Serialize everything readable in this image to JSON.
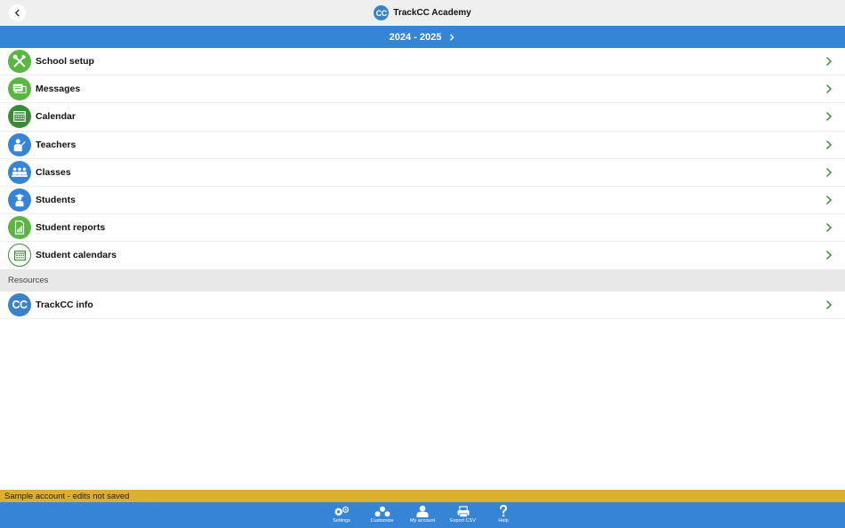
{
  "header": {
    "title": "TrackCC Academy",
    "logo_text": "CC"
  },
  "year_bar": {
    "label": "2024 - 2025"
  },
  "menu": {
    "items": [
      {
        "label": "School setup",
        "icon": "tools-icon"
      },
      {
        "label": "Messages",
        "icon": "messages-icon"
      },
      {
        "label": "Calendar",
        "icon": "calendar-icon"
      },
      {
        "label": "Teachers",
        "icon": "teacher-icon"
      },
      {
        "label": "Classes",
        "icon": "classes-icon"
      },
      {
        "label": "Students",
        "icon": "student-icon"
      },
      {
        "label": "Student reports",
        "icon": "report-icon"
      },
      {
        "label": "Student calendars",
        "icon": "calendar-outline-icon"
      }
    ]
  },
  "resources": {
    "header": "Resources",
    "items": [
      {
        "label": "TrackCC info",
        "icon_text": "CC"
      }
    ]
  },
  "banner": {
    "text": "Sample account - edits not saved"
  },
  "tabbar": {
    "tabs": [
      {
        "label": "Settings",
        "icon": "settings-icon"
      },
      {
        "label": "Customize",
        "icon": "customize-icon"
      },
      {
        "label": "My account",
        "icon": "account-icon"
      },
      {
        "label": "Export CSV",
        "icon": "export-icon"
      },
      {
        "label": "Help",
        "icon": "help-icon"
      }
    ]
  },
  "colors": {
    "primary_blue": "#3584d6",
    "green": "#5ab543",
    "dark_green": "#3c8a38",
    "banner_yellow": "#dcb02c",
    "topbar_gray": "#efefef"
  }
}
